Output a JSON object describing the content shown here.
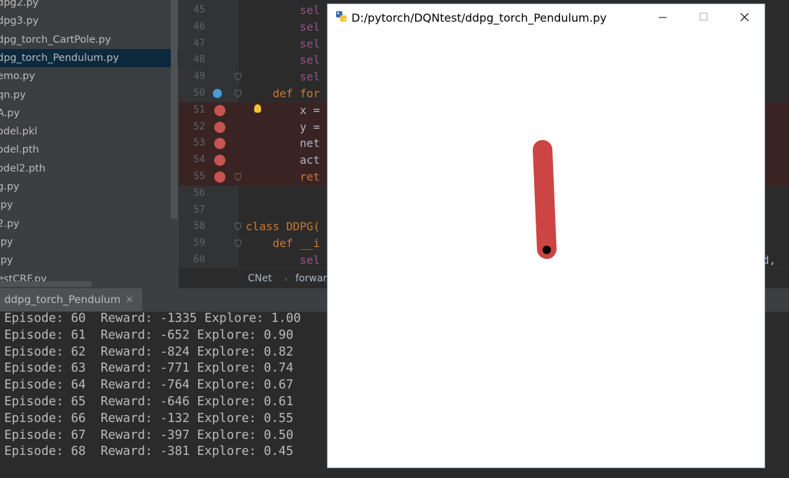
{
  "project_tree": {
    "items": [
      {
        "label": "dpg2.py",
        "selected": false
      },
      {
        "label": "dpg3.py",
        "selected": false
      },
      {
        "label": "dpg_torch_CartPole.py",
        "selected": false
      },
      {
        "label": "dpg_torch_Pendulum.py",
        "selected": true
      },
      {
        "label": "emo.py",
        "selected": false
      },
      {
        "label": "qn.py",
        "selected": false
      },
      {
        "label": "A.py",
        "selected": false
      },
      {
        "label": "odel.pkl",
        "selected": false
      },
      {
        "label": "odel.pth",
        "selected": false
      },
      {
        "label": "odel2.pth",
        "selected": false
      },
      {
        "label": "g.py",
        "selected": false
      },
      {
        "label": ".py",
        "selected": false
      },
      {
        "label": "2.py",
        "selected": false
      },
      {
        "label": ".py",
        "selected": false
      },
      {
        "label": ".py",
        "selected": false
      },
      {
        "label": "estCRF.py",
        "selected": false
      }
    ]
  },
  "editor": {
    "lines": [
      {
        "num": "45",
        "code": "        sel"
      },
      {
        "num": "46",
        "code": "        sel"
      },
      {
        "num": "47",
        "code": "        sel"
      },
      {
        "num": "48",
        "code": "        sel"
      },
      {
        "num": "49",
        "code": "        sel"
      },
      {
        "num": "50",
        "code": "    def for"
      },
      {
        "num": "51",
        "code": "        x ="
      },
      {
        "num": "52",
        "code": "        y ="
      },
      {
        "num": "53",
        "code": "        net"
      },
      {
        "num": "54",
        "code": "        act"
      },
      {
        "num": "55",
        "code": "        ret"
      },
      {
        "num": "56",
        "code": ""
      },
      {
        "num": "57",
        "code": ""
      },
      {
        "num": "58",
        "code": "class DDPG("
      },
      {
        "num": "59",
        "code": "    def __i"
      },
      {
        "num": "60",
        "code": "        sel"
      }
    ],
    "line60_tail": "d,",
    "breadcrumb": {
      "class": "CNet",
      "method": "forwar"
    }
  },
  "run_panel": {
    "tab_label": "ddpg_torch_Pendulum",
    "close_glyph": "×",
    "console_lines": [
      "Episode: 60  Reward: -1335 Explore: 1.00",
      "Episode: 61  Reward: -652 Explore: 0.90",
      "Episode: 62  Reward: -824 Explore: 0.82",
      "Episode: 63  Reward: -771 Explore: 0.74",
      "Episode: 64  Reward: -764 Explore: 0.67",
      "Episode: 65  Reward: -646 Explore: 0.61",
      "Episode: 66  Reward: -132 Explore: 0.55",
      "Episode: 67  Reward: -397 Explore: 0.50",
      "Episode: 68  Reward: -381 Explore: 0.45"
    ]
  },
  "render_window": {
    "title": "D:/pytorch/DQNtest/ddpg_torch_Pendulum.py",
    "pendulum_color": "#cc4444",
    "pivot_color": "#000000"
  }
}
